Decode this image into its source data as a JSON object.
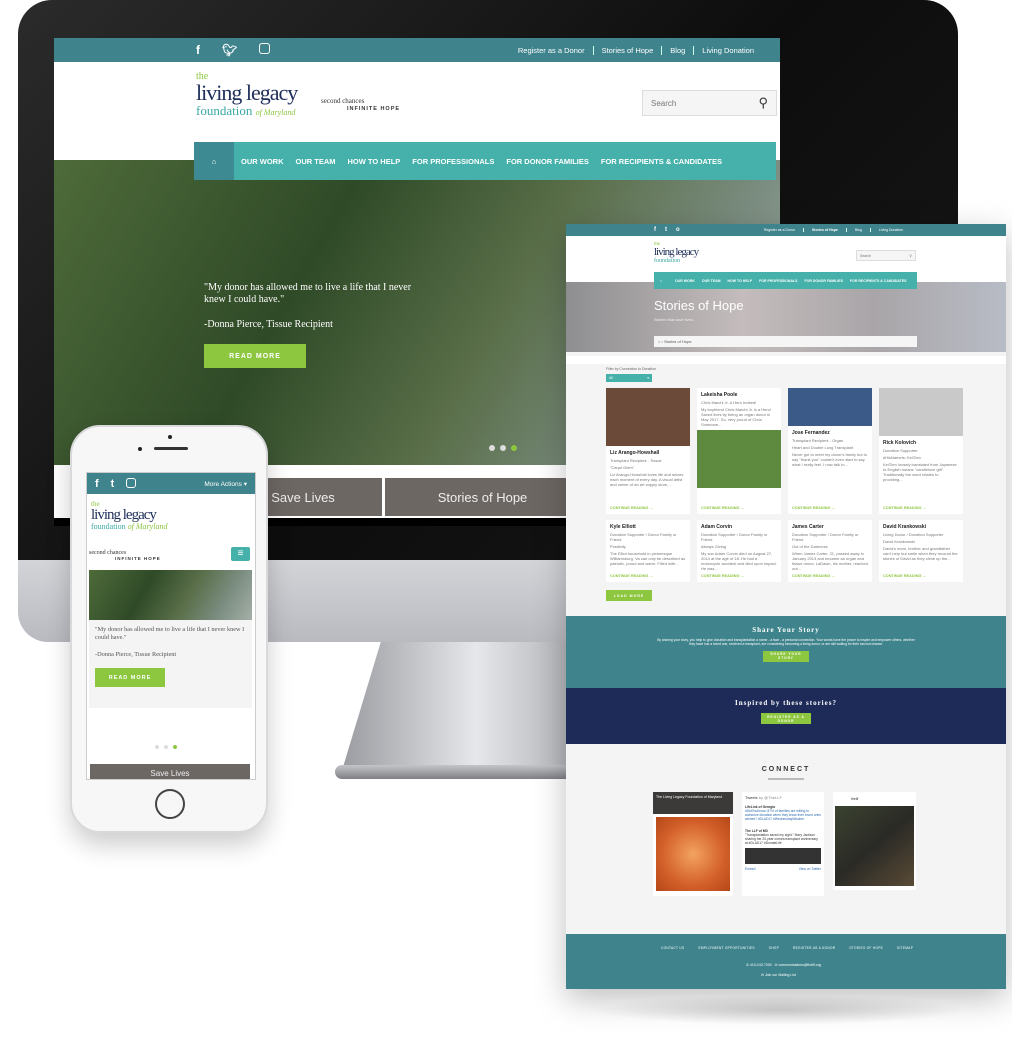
{
  "desktop": {
    "social_icons": [
      "facebook-icon",
      "twitter-icon",
      "instagram-icon"
    ],
    "top_links": [
      "Register as a Donor",
      "Stories of Hope",
      "Blog",
      "Living Donation"
    ],
    "logo": {
      "the": "the",
      "name": "living legacy",
      "foundation": "foundation",
      "state": "of Maryland"
    },
    "tagline": {
      "line1": "second chances",
      "line2": "INFINITE HOPE"
    },
    "search_placeholder": "Search",
    "nav": [
      "OUR WORK",
      "OUR TEAM",
      "HOW TO HELP",
      "FOR PROFESSIONALS",
      "FOR DONOR FAMILIES",
      "FOR RECIPIENTS & CANDIDATES"
    ],
    "hero": {
      "quote": "\"My donor has allowed me to live a life that I never knew I could have.\"",
      "author": "-Donna Pierce, Tissue Recipient",
      "button": "READ MORE",
      "slides": 3,
      "active_slide": 3
    },
    "tabs": [
      "Save Lives",
      "Stories of Hope"
    ]
  },
  "stories_page": {
    "top_links": [
      "Register as a Donor",
      "Stories of Hope",
      "Blog",
      "Living Donation"
    ],
    "search_placeholder": "Search",
    "nav": [
      "OUR WORK",
      "OUR TEAM",
      "HOW TO HELP",
      "FOR PROFESSIONALS",
      "FOR DONOR FAMILIES",
      "FOR RECIPIENTS & CANDIDATES"
    ],
    "title": "Stories of Hope",
    "subtitle": "Stories that save lives.",
    "breadcrumb": "Stories of Hope",
    "filter_label": "Filter by Connection to Donation",
    "filter_value": "All",
    "stories": [
      {
        "name": "Liz Arango-Howshall",
        "role": "Transplant Recipient - Tissue",
        "title": "\"Carpe Diem\"",
        "excerpt": "Liz Arango-Howshall loves life and seizes each moment of every day. A visual artist and owner of an art supply store,...",
        "link": "CONTINUE READING →"
      },
      {
        "name": "Lakeisha Poole",
        "role": "",
        "title": "Chris Marchi Jr. A Hero Indeed!",
        "excerpt": "My boyfriend Chris Marchi Jr. is a Hero! Saved lives by being an organ donor in May 2017. So, very proud of Chris. Someone...",
        "link": "CONTINUE READING →"
      },
      {
        "name": "Jose Fernandez",
        "role": "Transplant Recipient - Organ",
        "title": "Heart and Double Lung Transplant",
        "excerpt": "Never got to meet my donor's family but to say \"thank you\" couldn't even start to say what I really feel. I now talk to...",
        "link": "CONTINUE READING →"
      },
      {
        "name": "Rick Kolovich",
        "role": "Donation Supporter",
        "title": "#HisNameIs: Kei'Den",
        "excerpt": "Kei'Den loosely translated from Japanese to English means \"candlelove gift\". Traditionally the word relates to providing...",
        "link": "CONTINUE READING →"
      },
      {
        "name": "Kyle Elliott",
        "role": "Donation Supporter / Donor Family or Friend",
        "title": "Positivity",
        "excerpt": "The Elliot household in picturesque Williamsburg, Va can only be described as patriotic, proud and warm. Filled with...",
        "link": "CONTINUE READING →"
      },
      {
        "name": "Adam Corvin",
        "role": "Donation Supporter / Donor Family or Friend",
        "title": "Always Giving",
        "excerpt": "My son Adam Corvin died on August 27, 2014 at the age of 18. He had a motorcycle accident and died upon impact. He was...",
        "link": "CONTINUE READING →"
      },
      {
        "name": "James Carter",
        "role": "Donation Supporter / Donor Family or Friend",
        "title": "Out of the Darkness",
        "excerpt": "When James Carter, 21, passed away in January 2013 and became an organ and tissue donor, LaDawn, his mother, reached out...",
        "link": "CONTINUE READING →"
      },
      {
        "name": "David Krankowski",
        "role": "Living Donor / Donation Supporter",
        "title": "David Krankowski",
        "excerpt": "David's mom, brother and grandfather can't help but smile when they recount the stories of David as they climb up the...",
        "link": "CONTINUE READING →"
      }
    ],
    "load_more": "LOAD MORE",
    "share": {
      "title": "Share Your Story",
      "text": "By sharing your story, you help to give donation and transplantation a name - a face - a personal connection. Your words have the power to inspire and empower others, whether they have lost a loved one, received a transplant, are considering becoming a living donor, or are still waiting for their second chance.",
      "button": "SHARE YOUR STORY"
    },
    "inspired": {
      "title": "Inspired by these stories?",
      "button": "REGISTER AS A DONOR"
    },
    "connect": {
      "title": "CONNECT",
      "facebook_page": "The Living Legacy Foundation of Maryland",
      "tweets_label": "Tweets",
      "tweets_by": "by @TheLLF",
      "tweet1_author": "LifeLink of Georgia",
      "tweet1": "#DidYouKnow: 87% of families are willing to authorize donation when they know their loved ones wishes? #DLAD17 #WednesdayWisdom",
      "tweet2_author": "The LLF of MD",
      "tweet2": "\"Transplantation saved my sight.\" Mary Jackson sharing her 20-year cornea transplant anniversary at #DLAD17 #DonateLife",
      "embed": "Embed",
      "view_on_twitter": "View on Twitter",
      "instagram_handle": "thellf"
    },
    "footer": {
      "links": [
        "CONTACT US",
        "EMPLOYMENT OPPORTUNITIES",
        "SHOP",
        "REGISTER AS A DONOR",
        "STORIES OF HOPE",
        "SITEMAP"
      ],
      "phone": "410-242-7000",
      "email": "communications@thellf.org",
      "mailing": "Join our Mailing List"
    }
  },
  "mobile": {
    "more_actions": "More Actions",
    "quote": "\"My donor has allowed me to live a life that I never knew I could have.\"",
    "author": "-Donna Pierce, Tissue Recipient",
    "button": "READ MORE",
    "tab": "Save Lives",
    "slides": 3,
    "active_slide": 3
  },
  "colors": {
    "teal": "#3f848d",
    "nav_teal": "#45b1aa",
    "green": "#8dc63f",
    "navy": "#1e2b58",
    "gray_tab": "#6d6764"
  }
}
